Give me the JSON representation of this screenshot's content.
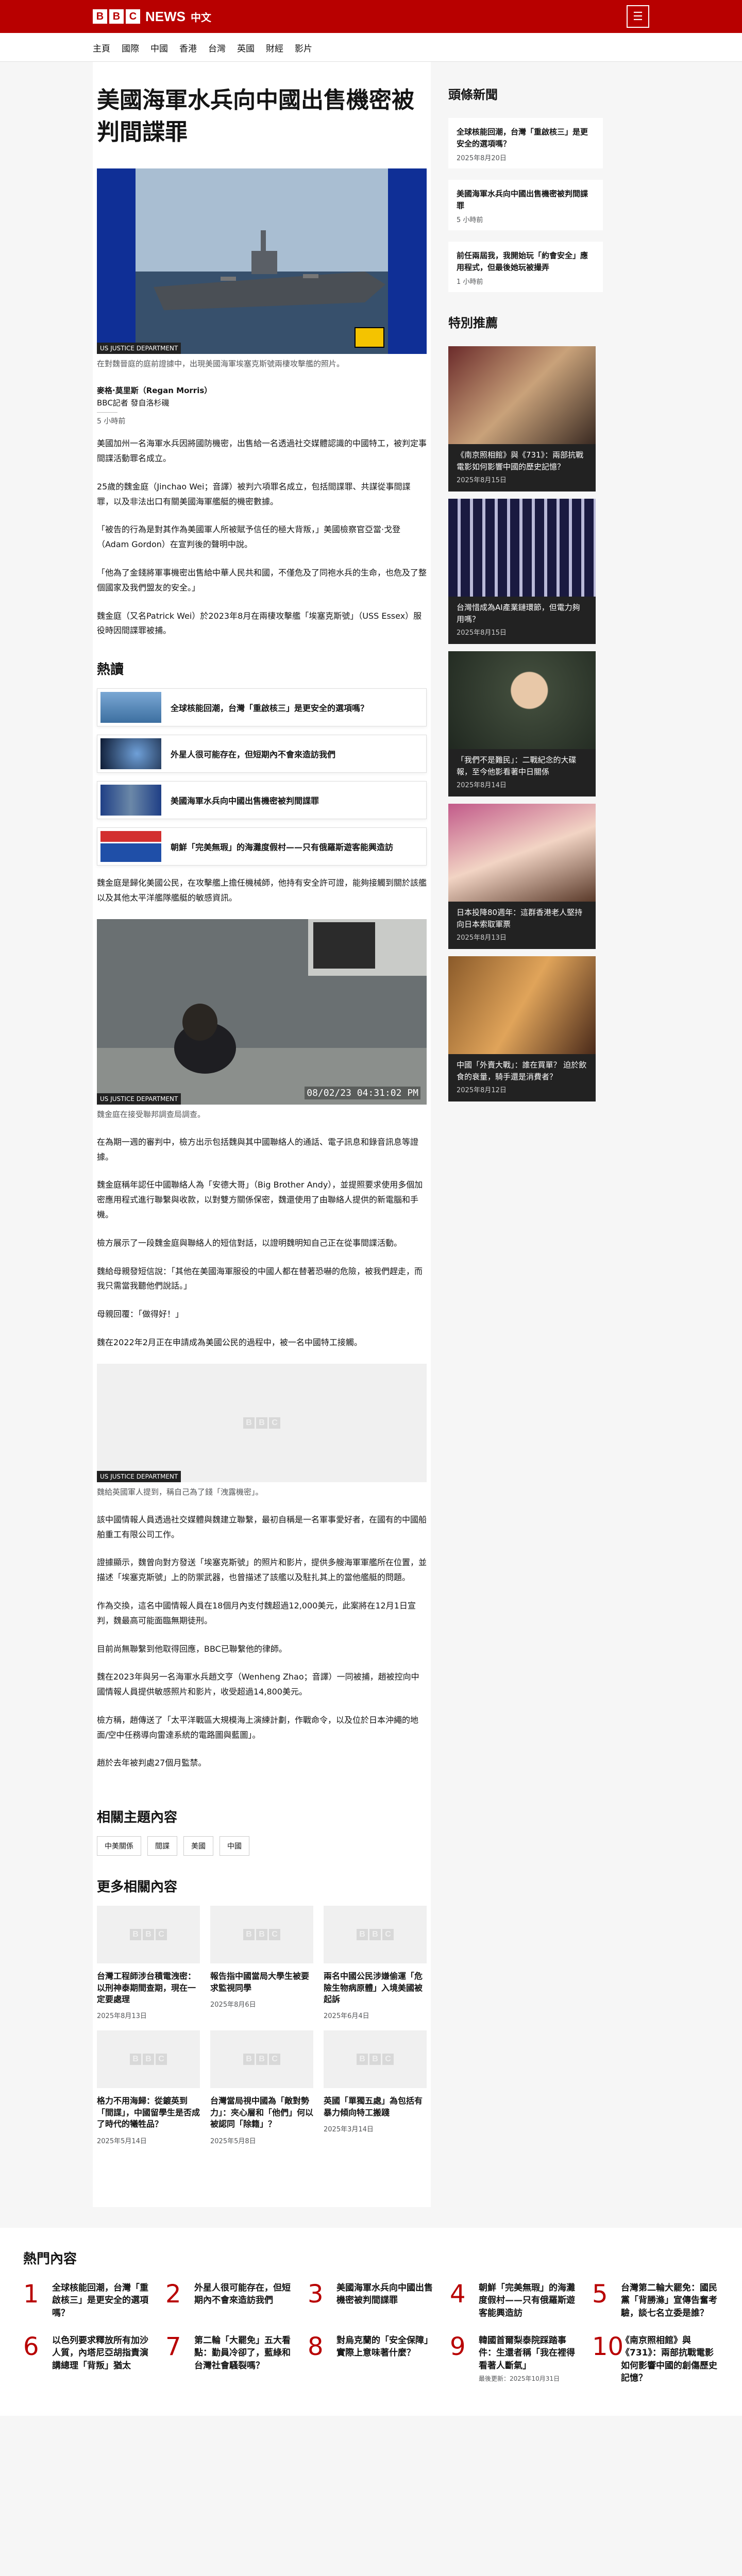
{
  "header": {
    "brand_b1": "B",
    "brand_b2": "B",
    "brand_b3": "C",
    "brand_news": "NEWS",
    "brand_lang": "中文",
    "menu_icon": "menu-icon"
  },
  "nav": [
    "主頁",
    "國際",
    "中國",
    "香港",
    "台灣",
    "英國",
    "財經",
    "影片"
  ],
  "article": {
    "title": "美國海軍水兵向中國出售機密被判間諜罪",
    "hero_credit": "US JUSTICE DEPARTMENT",
    "hero_caption": "在對魏晉庭的庭前證據中，出現美國海軍埃塞克斯號兩棲攻擊艦的照片。",
    "author": "麥格·莫里斯（Regan Morris）",
    "author_role": "BBC記者 發自洛杉磯",
    "time": "5 小時前",
    "p1": "美國加州一名海軍水兵因將國防機密，出售給一名透過社交媒體認識的中國特工，被判定事間諜活動罪名成立。",
    "p2": "25歲的魏金庭（Jinchao Wei；音譯）被判六項罪名成立，包括間諜罪、共謀從事間諜罪，以及非法出口有關美國海軍艦艇的機密數據。",
    "p3": "「被告的行為是對其作為美國軍人所被賦予信任的極大背叛，」美國檢察官亞當·戈登（Adam Gordon）在宣判後的聲明中說。",
    "p4": "「他為了金錢將軍事機密出售給中華人民共和國，不僅危及了同袍水兵的生命，也危及了整個國家及我們盟友的安全。」",
    "p5": "魏金庭（又名Patrick Wei）於2023年8月在兩棲攻擊艦「埃塞克斯號」（USS Essex）服役時因間諜罪被捕。",
    "popular_heading": "熱讀",
    "popular": [
      "全球核能回潮，台灣「重啟核三」是更安全的選項嗎？",
      "外星人很可能存在，但短期內不會來造訪我們",
      "美國海軍水兵向中國出售機密被判間諜罪",
      "朝鮮「完美無瑕」的海灘度假村——只有俄羅斯遊客能興造訪"
    ],
    "p6": "魏金庭是歸化美國公民，在攻擊艦上擔任機械師，他持有安全許可證，能夠接觸到關於該艦以及其他太平洋艦隊艦艇的敏感資訊。",
    "img2_credit": "US JUSTICE DEPARTMENT",
    "img2_stamp": "08/02/23 04:31:02 PM",
    "img2_caption": "魏金庭在接受聯邦調查局調查。",
    "p7": "在為期一週的審判中，檢方出示包括魏與其中國聯絡人的通話、電子訊息和錄音訊息等證據。",
    "p8": "魏金庭稱年認任中國聯絡人為「安德大哥」（Big Brother Andy），並提照要求使用多個加密應用程式進行聯繫與收款，以對雙方關係保密，魏還使用了由聯絡人提供的新電腦和手機。",
    "p9": "檢方展示了一段魏金庭與聯絡人的短信對話，以證明魏明知自己正在從事間諜活動。",
    "p10": "魏給母親發短信說：「其他在美國海軍服役的中國人都在替著恐嚇的危險，被我們趕走，而我只需當我聽他們說話。」",
    "p11": "母親回覆：「做得好！」",
    "p12": "魏在2022年2月正在申請成為美國公民的過程中，被一名中國特工接觸。",
    "img3_credit": "US JUSTICE DEPARTMENT",
    "img3_caption": "魏給英國軍人提到，稱自己為了錢「洩露機密」。",
    "p13": "該中國情報人員透過社交媒體與魏建立聯繫，最初自稱是一名軍事愛好者，在國有的中國船舶重工有限公司工作。",
    "p14": "證據顯示，魏曾向對方發送「埃塞克斯號」的照片和影片，提供多艘海軍軍艦所在位置，並描述「埃塞克斯號」上的防禦武器，也曾描述了該艦以及駐扎其上的當他艦艇的問題。",
    "p15": "作為交換，這名中國情報人員在18個月內支付魏超過12,000美元，此案將在12月1日宣判，魏最高可能面臨無期徒刑。",
    "p16": "目前尚無聯繫到他取得回應，BBC已聯繫他的律師。",
    "p17": "魏在2023年與另一名海軍水兵趙文亨（Wenheng Zhao；音譯）一同被捕，趙被控向中國情報人員提供敏感照片和影片，收受超過14,800美元。",
    "p18": "檢方稱，趙傳送了「太平洋戰區大規模海上演練計劃，作戰命令，以及位於日本沖繩的地面/空中任務導向雷達系統的電路圖與藍圖」。",
    "p19": "趙於去年被判處27個月監禁。",
    "topics_heading": "相關主題內容",
    "topics": [
      "中美關係",
      "間諜",
      "美國",
      "中國"
    ],
    "more_heading": "更多相關內容",
    "more": [
      {
        "title": "台灣工程師涉台積電洩密：以刑神泰期間查期，現在一定要處理",
        "date": "2025年8月13日"
      },
      {
        "title": "報告指中國當局大學生被要求監視同學",
        "date": "2025年8月6日"
      },
      {
        "title": "兩名中國公民涉嫌偷運「危險生物病原體」入境美國被起訴",
        "date": "2025年6月4日"
      },
      {
        "title": "格力不用海歸：從鍍英到「間諜」，中國留學生是否成了時代的犧牲品？",
        "date": "2025年5月14日"
      },
      {
        "title": "台灣當局視中國為「敵對勢力」：夾心層和「他們」何以被認同「除籍」？",
        "date": "2025年5月8日"
      },
      {
        "title": "英國「單獨五處」為包括有暴力傾向特工搬踐",
        "date": "2025年3月14日"
      }
    ]
  },
  "sidebar": {
    "headlines_heading": "頭條新聞",
    "headlines": [
      {
        "title": "全球核能回潮，台灣「重啟核三」是更安全的選項嗎？",
        "date": "2025年8月20日"
      },
      {
        "title": "美國海軍水兵向中國出售機密被判間諜罪",
        "date": "5 小時前"
      },
      {
        "title": "前任兩屆我，我開始玩「約會安全」應用程式，但最後她玩被撮弄",
        "date": "1 小時前"
      }
    ],
    "featured_heading": "特別推薦",
    "featured": [
      {
        "title": "《南京照相館》與《731》：兩部抗戰電影如何影響中國的歷史記憶？",
        "date": "2025年8月15日"
      },
      {
        "title": "台灣惜成為AI產業鏈環節，但電力夠用嗎？",
        "date": "2025年8月15日"
      },
      {
        "title": "「我們不是難民」：二戰紀念的大碟報，至今他影看著中日關係",
        "date": "2025年8月14日"
      },
      {
        "title": "日本投降80週年：這群香港老人堅持向日本索取軍票",
        "date": "2025年8月13日"
      },
      {
        "title": "中國「外賣大戰」：誰在買單？ 迫於飲食的衰量，騎手還是消費者？",
        "date": "2025年8月12日"
      }
    ]
  },
  "most_read": {
    "heading": "熱門內容",
    "items": [
      {
        "n": "1",
        "title": "全球核能回潮，台灣「重啟核三」是更安全的選項嗎？",
        "date": ""
      },
      {
        "n": "2",
        "title": "外星人很可能存在，但短期內不會來造訪我們",
        "date": ""
      },
      {
        "n": "3",
        "title": "美國海軍水兵向中國出售機密被判間諜罪",
        "date": ""
      },
      {
        "n": "4",
        "title": "朝鮮「完美無瑕」的海灘度假村——只有俄羅斯遊客能興造訪",
        "date": ""
      },
      {
        "n": "5",
        "title": "台灣第二輪大罷免：國民黨「背勝滌」宣傳告奮考驗，談七名立委是誰？",
        "date": ""
      },
      {
        "n": "6",
        "title": "以色列要求釋放所有加沙人質，內塔尼亞胡指責演講總理「背叛」猶太",
        "date": ""
      },
      {
        "n": "7",
        "title": "第二輪「大罷免」五大看點：勤員冷卻了，藍綠和台灣社會騷裂嗎？",
        "date": ""
      },
      {
        "n": "8",
        "title": "對烏克蘭的「安全保障」實際上意味著什麼？",
        "date": ""
      },
      {
        "n": "9",
        "title": "韓國首爾梨泰院踩踏事件：生還者稱「我在裡得看著人斷氣」",
        "date": "最後更新：2025年10月31日"
      },
      {
        "n": "10",
        "title": "《南京照相館》與《731》：兩部抗戰電影如何影響中國的創傷歷史記憶？",
        "date": ""
      }
    ]
  },
  "placeholder": {
    "b1": "B",
    "b2": "B",
    "b3": "C"
  }
}
